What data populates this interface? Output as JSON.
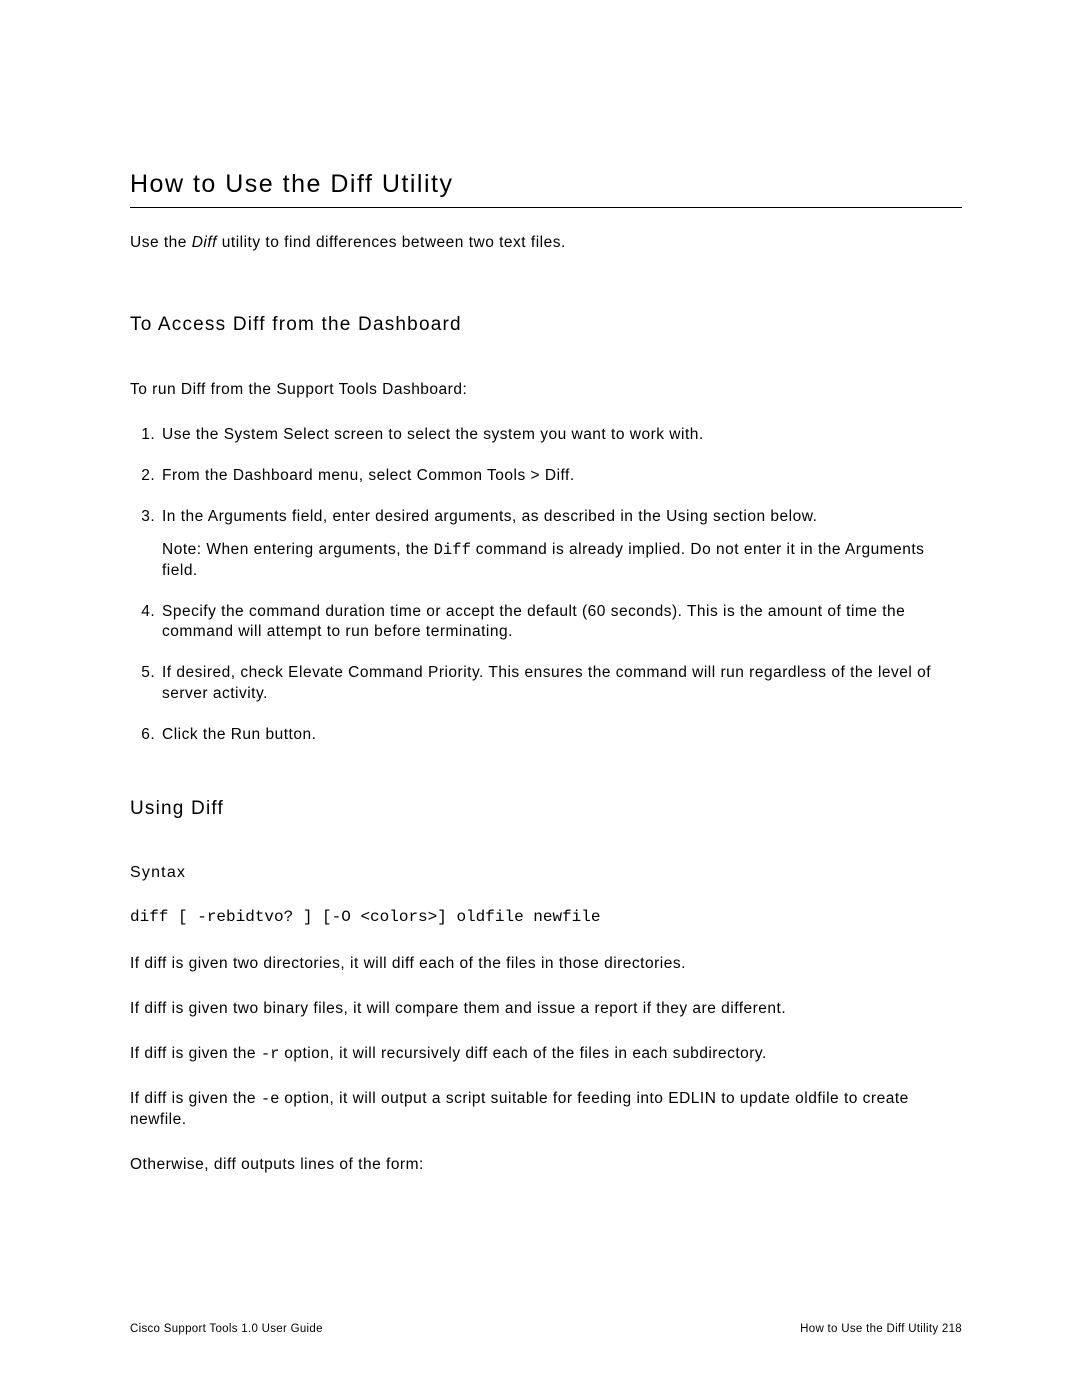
{
  "title": "How to Use the Diff Utility",
  "intro_pre": "Use the ",
  "intro_em": "Diff",
  "intro_post": " utility to find differences between two text files.",
  "section_access": {
    "heading": "To Access Diff from the Dashboard",
    "lead": "To run Diff from the Support Tools Dashboard:",
    "steps": {
      "s1": "Use the System Select screen to select the system you want to work with.",
      "s2": "From the Dashboard menu, select Common Tools > Diff.",
      "s3_a": "In the Arguments field, enter desired arguments, as described in the Using section below.",
      "s3_note_pre": "Note: When entering arguments, the ",
      "s3_note_code": "Diff",
      "s3_note_post": " command is already implied. Do not enter it in the Arguments field.",
      "s4": "Specify the command duration time or accept the default (60 seconds). This is the amount of time the command will attempt to run before terminating.",
      "s5": "If desired, check Elevate Command Priority. This ensures the command will run regardless of the level of server activity.",
      "s6": "Click the Run button."
    }
  },
  "section_using": {
    "heading": "Using Diff",
    "syntax_label": "Syntax",
    "syntax_line": "diff [ -rebidtvo? ] [-O <colors>] oldfile newfile",
    "p1": "If diff is given two directories, it will diff each of the files in those directories.",
    "p2": "If diff is given two binary files, it will compare them and issue a report if they are different.",
    "p3_pre": "If diff is given the ",
    "p3_code": "-r",
    "p3_post": " option, it will recursively diff each of the files in each subdirectory.",
    "p4_pre": "If diff is given the ",
    "p4_code": "-e",
    "p4_post": " option, it will output a script suitable for feeding into EDLIN to update oldfile to create newfile.",
    "p5": "Otherwise, diff outputs lines of the form:"
  },
  "footer": {
    "left": "Cisco Support Tools 1.0 User Guide",
    "right": "How to Use the Diff Utility   218"
  }
}
